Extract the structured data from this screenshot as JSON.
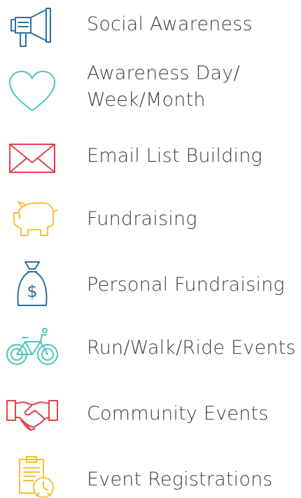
{
  "items": [
    {
      "label": "Social Awareness",
      "icon": "megaphone-icon",
      "color": "#2e6f9e"
    },
    {
      "label_line1": "Awareness Day/",
      "label_line2": "Week/Month",
      "icon": "heart-icon",
      "color": "#4cc6b6"
    },
    {
      "label": "Email List Building",
      "icon": "envelope-icon",
      "color": "#e0434d"
    },
    {
      "label": "Fundraising",
      "icon": "piggy-bank-icon",
      "color": "#f2c13a"
    },
    {
      "label": "Personal Fundraising",
      "icon": "money-bag-icon",
      "color": "#2e6f9e"
    },
    {
      "label": "Run/Walk/Ride Events",
      "icon": "bicycle-icon",
      "color": "#4cc6b6"
    },
    {
      "label": "Community Events",
      "icon": "handshake-icon",
      "color": "#e0434d"
    },
    {
      "label": "Event Registrations",
      "icon": "clipboard-clock-icon",
      "color": "#f2c13a"
    }
  ]
}
